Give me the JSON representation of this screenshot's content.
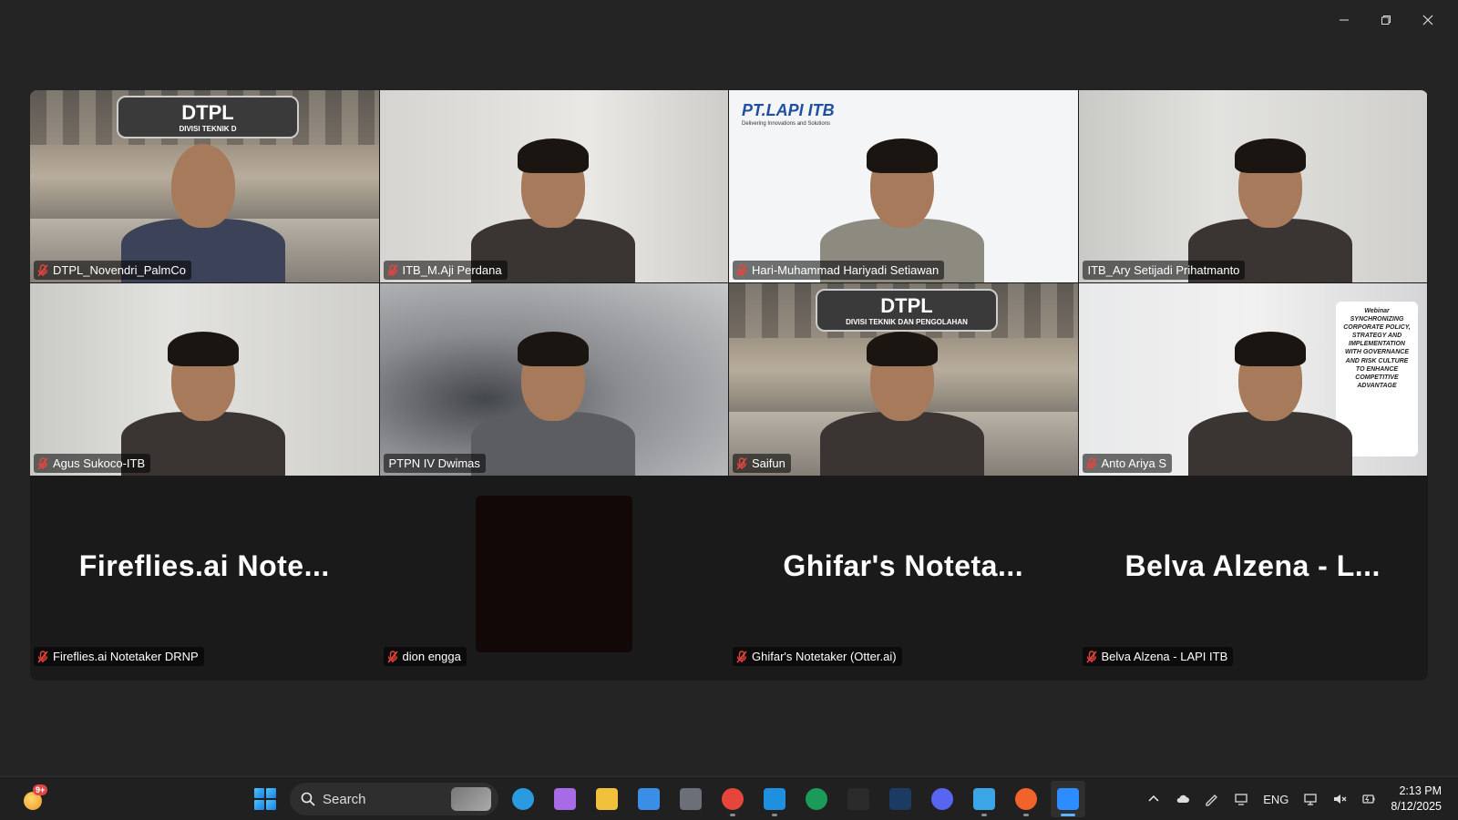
{
  "window": {
    "minimize_label": "Minimize",
    "restore_label": "Restore",
    "close_label": "Close"
  },
  "tiles": [
    {
      "name": "DTPL_Novendri_PalmCo",
      "muted": true,
      "bg": "factory",
      "sign": "DTPL",
      "sign_sub": "DIVISI TEKNIK D"
    },
    {
      "name": "ITB_M.Aji Perdana",
      "muted": true,
      "bg": "white"
    },
    {
      "name": "Hari-Muhammad Hariyadi Setiawan",
      "muted": true,
      "bg": "lapi",
      "logo": "PT.LAPI ITB",
      "logo_sub": "Delivering Innovations and Solutions"
    },
    {
      "name": "ITB_Ary Setijadi Prihatmanto",
      "muted": false,
      "bg": "office"
    },
    {
      "name": "Agus Sukoco-ITB",
      "muted": true,
      "bg": "office"
    },
    {
      "name": "PTPN IV Dwimas",
      "muted": false,
      "bg": "blurred",
      "active": true
    },
    {
      "name": "Saifun",
      "muted": true,
      "bg": "factory",
      "sign": "DTPL",
      "sign_sub": "DIVISI TEKNIK DAN PENGOLAHAN"
    },
    {
      "name": "Anto Ariya S",
      "muted": true,
      "bg": "room",
      "webinar": "Webinar SYNCHRONIZING CORPORATE POLICY, STRATEGY AND IMPLEMENTATION WITH GOVERNANCE AND RISK CULTURE TO ENHANCE COMPETITIVE ADVANTAGE"
    },
    {
      "name": "Fireflies.ai Notetaker DRNP",
      "muted": true,
      "display": "Fireflies.ai  Note..."
    },
    {
      "name": "dion engga",
      "muted": true,
      "black": true
    },
    {
      "name": "Ghifar's Notetaker (Otter.ai)",
      "muted": true,
      "display": "Ghifar's  Noteta..."
    },
    {
      "name": "Belva Alzena - LAPI ITB",
      "muted": true,
      "display": "Belva Alzena - L..."
    }
  ],
  "taskbar": {
    "weather_badge": "9+",
    "search_label": "Search",
    "apps": [
      {
        "name": "edge",
        "color": "#2a9be0"
      },
      {
        "name": "copilot",
        "color": "#a86be8"
      },
      {
        "name": "file-explorer",
        "color": "#f2c13b"
      },
      {
        "name": "microsoft-store",
        "color": "#3a8ee6"
      },
      {
        "name": "app-hexagon",
        "color": "#6a6f78"
      },
      {
        "name": "chrome",
        "color": "#e6453a"
      },
      {
        "name": "vscode",
        "color": "#1f8fe0"
      },
      {
        "name": "app-leaf",
        "color": "#1b9b5a"
      },
      {
        "name": "epic-games",
        "color": "#2b2b2b"
      },
      {
        "name": "steam",
        "color": "#1b3b63"
      },
      {
        "name": "discord",
        "color": "#5865f2"
      },
      {
        "name": "notepad",
        "color": "#3aa6e6"
      },
      {
        "name": "app-orange",
        "color": "#f2622b"
      },
      {
        "name": "zoom",
        "color": "#2d8cff"
      }
    ],
    "language": "ENG",
    "time": "2:13 PM",
    "date": "8/12/2025"
  }
}
